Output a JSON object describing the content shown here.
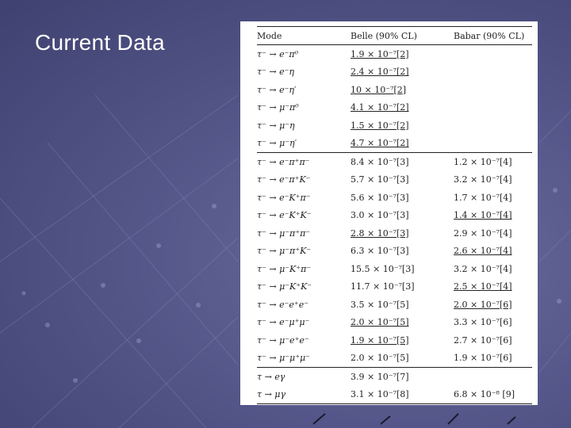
{
  "slide": {
    "title": "Current Data"
  },
  "table": {
    "headers": {
      "mode": "Mode",
      "belle": "Belle (90% CL)",
      "babar": "Babar (90% CL)"
    },
    "rows": [
      {
        "mode": "τ⁻ → e⁻π⁰",
        "belle": "1.9 × 10⁻⁷[2]",
        "babar": ""
      },
      {
        "mode": "τ⁻ → e⁻η",
        "belle": "2.4 × 10⁻⁷[2]",
        "babar": ""
      },
      {
        "mode": "τ⁻ → e⁻η′",
        "belle": "10 × 10⁻⁷[2]",
        "babar": ""
      },
      {
        "mode": "τ⁻ → μ⁻π⁰",
        "belle": "4.1 × 10⁻⁷[2]",
        "babar": ""
      },
      {
        "mode": "τ⁻ → μ⁻η",
        "belle": "1.5 × 10⁻⁷[2]",
        "babar": ""
      },
      {
        "mode": "τ⁻ → μ⁻η′",
        "belle": "4.7 × 10⁻⁷[2]",
        "babar": ""
      },
      {
        "mode": "τ⁻ → e⁻π⁺π⁻",
        "belle": "8.4 × 10⁻⁷[3]",
        "babar": "1.2 × 10⁻⁷[4]"
      },
      {
        "mode": "τ⁻ → e⁻π⁺K⁻",
        "belle": "5.7 × 10⁻⁷[3]",
        "babar": "3.2 × 10⁻⁷[4]"
      },
      {
        "mode": "τ⁻ → e⁻K⁺π⁻",
        "belle": "5.6 × 10⁻⁷[3]",
        "babar": "1.7 × 10⁻⁷[4]"
      },
      {
        "mode": "τ⁻ → e⁻K⁺K⁻",
        "belle": "3.0 × 10⁻⁷[3]",
        "babar": "1.4 × 10⁻⁷[4]"
      },
      {
        "mode": "τ⁻ → μ⁻π⁺π⁻",
        "belle": "2.8 × 10⁻⁷[3]",
        "babar": "2.9 × 10⁻⁷[4]"
      },
      {
        "mode": "τ⁻ → μ⁻π⁺K⁻",
        "belle": "6.3 × 10⁻⁷[3]",
        "babar": "2.6 × 10⁻⁷[4]"
      },
      {
        "mode": "τ⁻ → μ⁻K⁺π⁻",
        "belle": "15.5 × 10⁻⁷[3]",
        "babar": "3.2 × 10⁻⁷[4]"
      },
      {
        "mode": "τ⁻ → μ⁻K⁺K⁻",
        "belle": "11.7 × 10⁻⁷[3]",
        "babar": "2.5 × 10⁻⁷[4]"
      },
      {
        "mode": "τ⁻ → e⁻e⁺e⁻",
        "belle": "3.5 × 10⁻⁷[5]",
        "babar": "2.0 × 10⁻⁷[6]"
      },
      {
        "mode": "τ⁻ → e⁻μ⁺μ⁻",
        "belle": "2.0 × 10⁻⁷[5]",
        "babar": "3.3 × 10⁻⁷[6]"
      },
      {
        "mode": "τ⁻ → μ⁻e⁺e⁻",
        "belle": "1.9 × 10⁻⁷[5]",
        "babar": "2.7 × 10⁻⁷[6]"
      },
      {
        "mode": "τ⁻ → μ⁻μ⁺μ⁻",
        "belle": "2.0 × 10⁻⁷[5]",
        "babar": "1.9 × 10⁻⁷[6]"
      },
      {
        "mode": "τ → eγ",
        "belle": "3.9 × 10⁻⁷[7]",
        "babar": ""
      },
      {
        "mode": "τ → μγ",
        "belle": "3.1 × 10⁻⁷[8]",
        "babar": "6.8 × 10⁻⁸ [9]"
      }
    ]
  }
}
